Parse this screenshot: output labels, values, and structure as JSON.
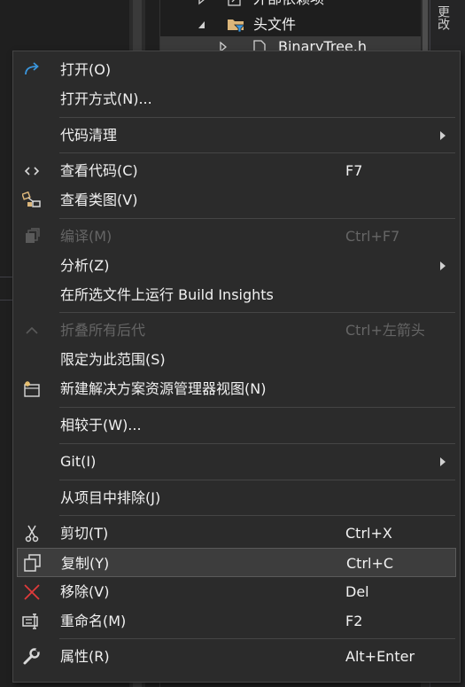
{
  "tree": {
    "rows": [
      {
        "label": "外部依赖项",
        "icon": "external-deps-icon"
      },
      {
        "label": "头文件",
        "icon": "filter-folder-icon"
      },
      {
        "label": "BinaryTree.h",
        "icon": "header-file-icon"
      }
    ],
    "side_tab_label": "更改"
  },
  "menu": {
    "items": [
      {
        "label": "打开(O)",
        "shortcut": "",
        "icon": "open-icon",
        "disabled": false,
        "submenu": false
      },
      {
        "label": "打开方式(N)...",
        "shortcut": "",
        "icon": "",
        "disabled": false,
        "submenu": false
      },
      {
        "label": "代码清理",
        "shortcut": "",
        "icon": "",
        "disabled": false,
        "submenu": true
      },
      {
        "label": "查看代码(C)",
        "shortcut": "F7",
        "icon": "view-code-icon",
        "disabled": false,
        "submenu": false
      },
      {
        "label": "查看类图(V)",
        "shortcut": "",
        "icon": "class-diagram-icon",
        "disabled": false,
        "submenu": false
      },
      {
        "label": "编译(M)",
        "shortcut": "Ctrl+F7",
        "icon": "compile-icon",
        "disabled": true,
        "submenu": false
      },
      {
        "label": "分析(Z)",
        "shortcut": "",
        "icon": "",
        "disabled": false,
        "submenu": true
      },
      {
        "label": "在所选文件上运行 Build Insights",
        "shortcut": "",
        "icon": "",
        "disabled": false,
        "submenu": false
      },
      {
        "label": "折叠所有后代",
        "shortcut": "Ctrl+左箭头",
        "icon": "collapse-icon",
        "disabled": true,
        "submenu": false
      },
      {
        "label": "限定为此范围(S)",
        "shortcut": "",
        "icon": "",
        "disabled": false,
        "submenu": false
      },
      {
        "label": "新建解决方案资源管理器视图(N)",
        "shortcut": "",
        "icon": "new-view-icon",
        "disabled": false,
        "submenu": false
      },
      {
        "label": "相较于(W)...",
        "shortcut": "",
        "icon": "",
        "disabled": false,
        "submenu": false
      },
      {
        "label": "Git(I)",
        "shortcut": "",
        "icon": "",
        "disabled": false,
        "submenu": true
      },
      {
        "label": "从项目中排除(J)",
        "shortcut": "",
        "icon": "",
        "disabled": false,
        "submenu": false
      },
      {
        "label": "剪切(T)",
        "shortcut": "Ctrl+X",
        "icon": "cut-icon",
        "disabled": false,
        "submenu": false
      },
      {
        "label": "复制(Y)",
        "shortcut": "Ctrl+C",
        "icon": "copy-icon",
        "disabled": false,
        "submenu": false,
        "highlighted": true
      },
      {
        "label": "移除(V)",
        "shortcut": "Del",
        "icon": "remove-icon",
        "disabled": false,
        "submenu": false
      },
      {
        "label": "重命名(M)",
        "shortcut": "F2",
        "icon": "rename-icon",
        "disabled": false,
        "submenu": false
      },
      {
        "label": "属性(R)",
        "shortcut": "Alt+Enter",
        "icon": "properties-icon",
        "disabled": false,
        "submenu": false
      }
    ]
  },
  "colors": {
    "menu_bg": "#2b2b2b",
    "menu_border": "#454545",
    "highlight_bg": "#3d3d3d",
    "text": "#f1f1f1",
    "disabled_text": "#656565",
    "accent_blue": "#3a96dd",
    "remove_red": "#e03a3a"
  }
}
